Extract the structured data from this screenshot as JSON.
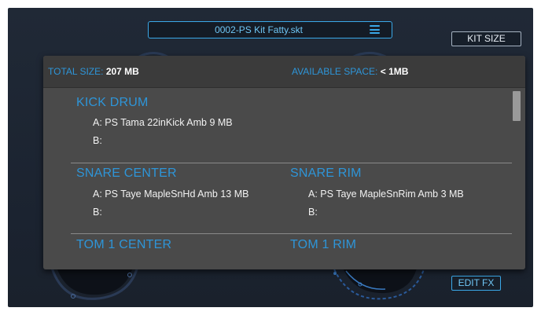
{
  "header": {
    "preset_name": "0002-PS Kit Fatty.skt",
    "kit_size_label": "KIT SIZE",
    "edit_fx_label": "EDIT FX"
  },
  "panel": {
    "total_size_label": "TOTAL SIZE:",
    "total_size_value": "207 MB",
    "available_space_label": "AVAILABLE SPACE:",
    "available_space_value": "< 1MB",
    "drums": [
      {
        "name": "KICK DRUM",
        "slot_a": "A: PS Tama 22inKick Amb  9 MB",
        "slot_b": "B:"
      },
      {
        "name": "SNARE CENTER",
        "slot_a": "A: PS Taye MapleSnHd Amb  13 MB",
        "slot_b": "B:"
      },
      {
        "name": "SNARE RIM",
        "slot_a": "A: PS Taye MapleSnRim Amb  3 MB",
        "slot_b": "B:"
      },
      {
        "name": "TOM 1 CENTER"
      },
      {
        "name": "TOM 1 RIM"
      }
    ]
  },
  "colors": {
    "accent": "#2e95d8",
    "panel_bg": "#4a4a4a",
    "app_bg": "#1d2531"
  }
}
